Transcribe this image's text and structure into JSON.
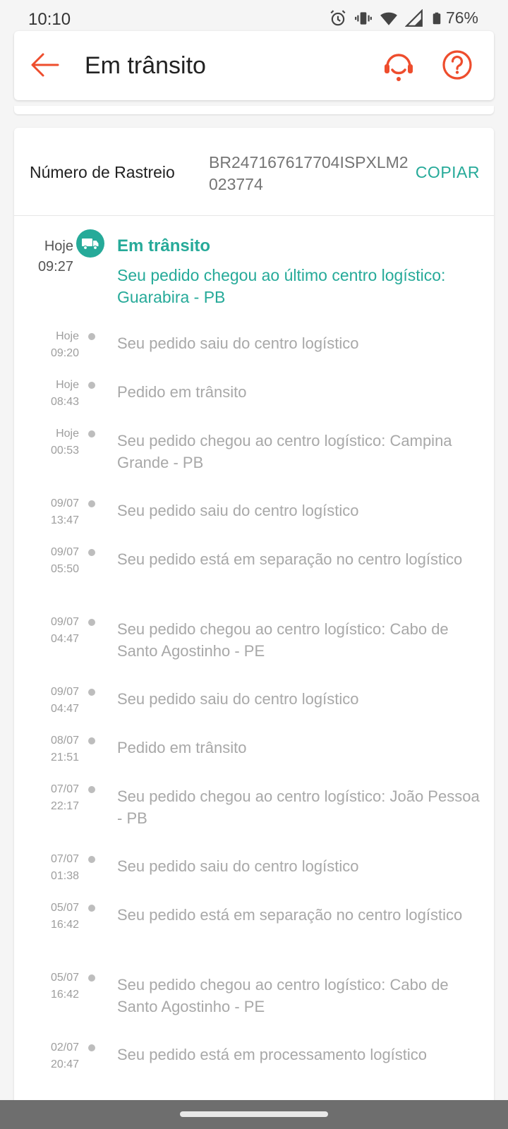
{
  "status_bar": {
    "time": "10:10",
    "battery": "76%",
    "icons": [
      "alarm-icon",
      "vibrate-icon",
      "wifi-icon",
      "signal-icon",
      "battery-icon"
    ]
  },
  "header": {
    "title": "Em trânsito",
    "back_icon": "arrow-left-icon",
    "support_icon": "headset-icon",
    "help_icon": "question-icon",
    "accent_color": "#ee4d2d"
  },
  "tracking": {
    "label": "Número de Rastreio",
    "number": "BR247167617704ISPXLM2023774",
    "copy_label": "COPIAR",
    "accent_color": "#26aa99"
  },
  "current_event": {
    "day": "Hoje",
    "time": "09:27",
    "title": "Em trânsito",
    "description": "Seu pedido chegou ao último centro logístico: Guarabira - PB"
  },
  "events": [
    {
      "day": "Hoje",
      "time": "09:20",
      "text": "Seu pedido saiu do centro logístico"
    },
    {
      "day": "Hoje",
      "time": "08:43",
      "text": "Pedido em trânsito"
    },
    {
      "day": "Hoje",
      "time": "00:53",
      "text": "Seu pedido chegou ao centro logístico: Campina Grande - PB"
    },
    {
      "day": "09/07",
      "time": "13:47",
      "text": "Seu pedido saiu do centro logístico"
    },
    {
      "day": "09/07",
      "time": "05:50",
      "text": "Seu pedido está em separação no centro logístico"
    },
    {
      "day": "09/07",
      "time": "04:47",
      "text": "Seu pedido chegou ao centro logístico: Cabo de Santo Agostinho - PE"
    },
    {
      "day": "09/07",
      "time": "04:47",
      "text": "Seu pedido saiu do centro logístico"
    },
    {
      "day": "08/07",
      "time": "21:51",
      "text": "Pedido em trânsito"
    },
    {
      "day": "07/07",
      "time": "22:17",
      "text": "Seu pedido chegou ao centro logístico: João Pessoa - PB"
    },
    {
      "day": "07/07",
      "time": "01:38",
      "text": "Seu pedido saiu do centro logístico"
    },
    {
      "day": "05/07",
      "time": "16:42",
      "text": "Seu pedido está em separação no centro logístico"
    },
    {
      "day": "05/07",
      "time": "16:42",
      "text": "Seu pedido chegou ao centro logístico: Cabo de Santo Agostinho - PE"
    },
    {
      "day": "02/07",
      "time": "20:47",
      "text": "Seu pedido está em processamento logístico"
    }
  ]
}
